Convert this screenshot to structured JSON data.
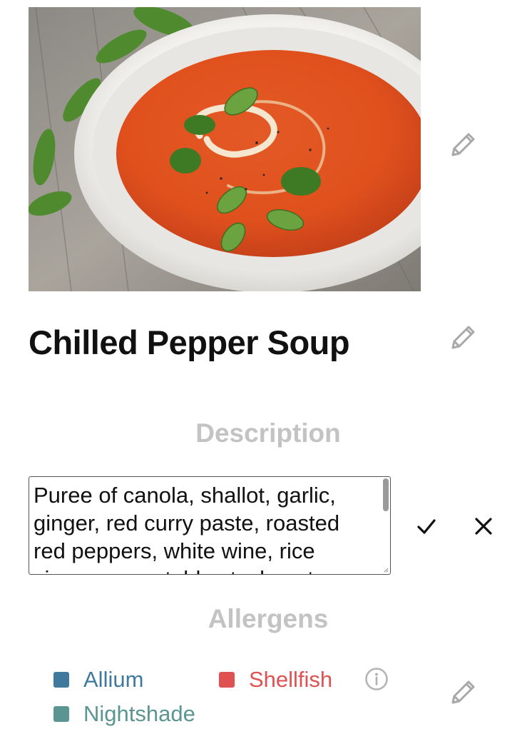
{
  "dish": {
    "title": "Chilled Pepper Soup",
    "photo_icon": "dish-photo"
  },
  "description": {
    "heading": "Description",
    "value": "Puree of canola, shallot, garlic, ginger, red curry paste, roasted red peppers, white wine, rice vinegar, vegetable stock, oat",
    "confirm_icon": "check-icon",
    "cancel_icon": "close-icon"
  },
  "allergens": {
    "heading": "Allergens",
    "items": [
      {
        "label": "Allium",
        "color": "#3f7a9e"
      },
      {
        "label": "Shellfish",
        "color": "#e05252"
      },
      {
        "label": "Nightshade",
        "color": "#5b9591"
      }
    ],
    "info_icon": "info-icon"
  },
  "icons": {
    "edit": "pencil-icon"
  },
  "colors": {
    "heading_muted": "#c3c3c3",
    "icon_gray": "#a8a8a8",
    "text": "#111111"
  }
}
